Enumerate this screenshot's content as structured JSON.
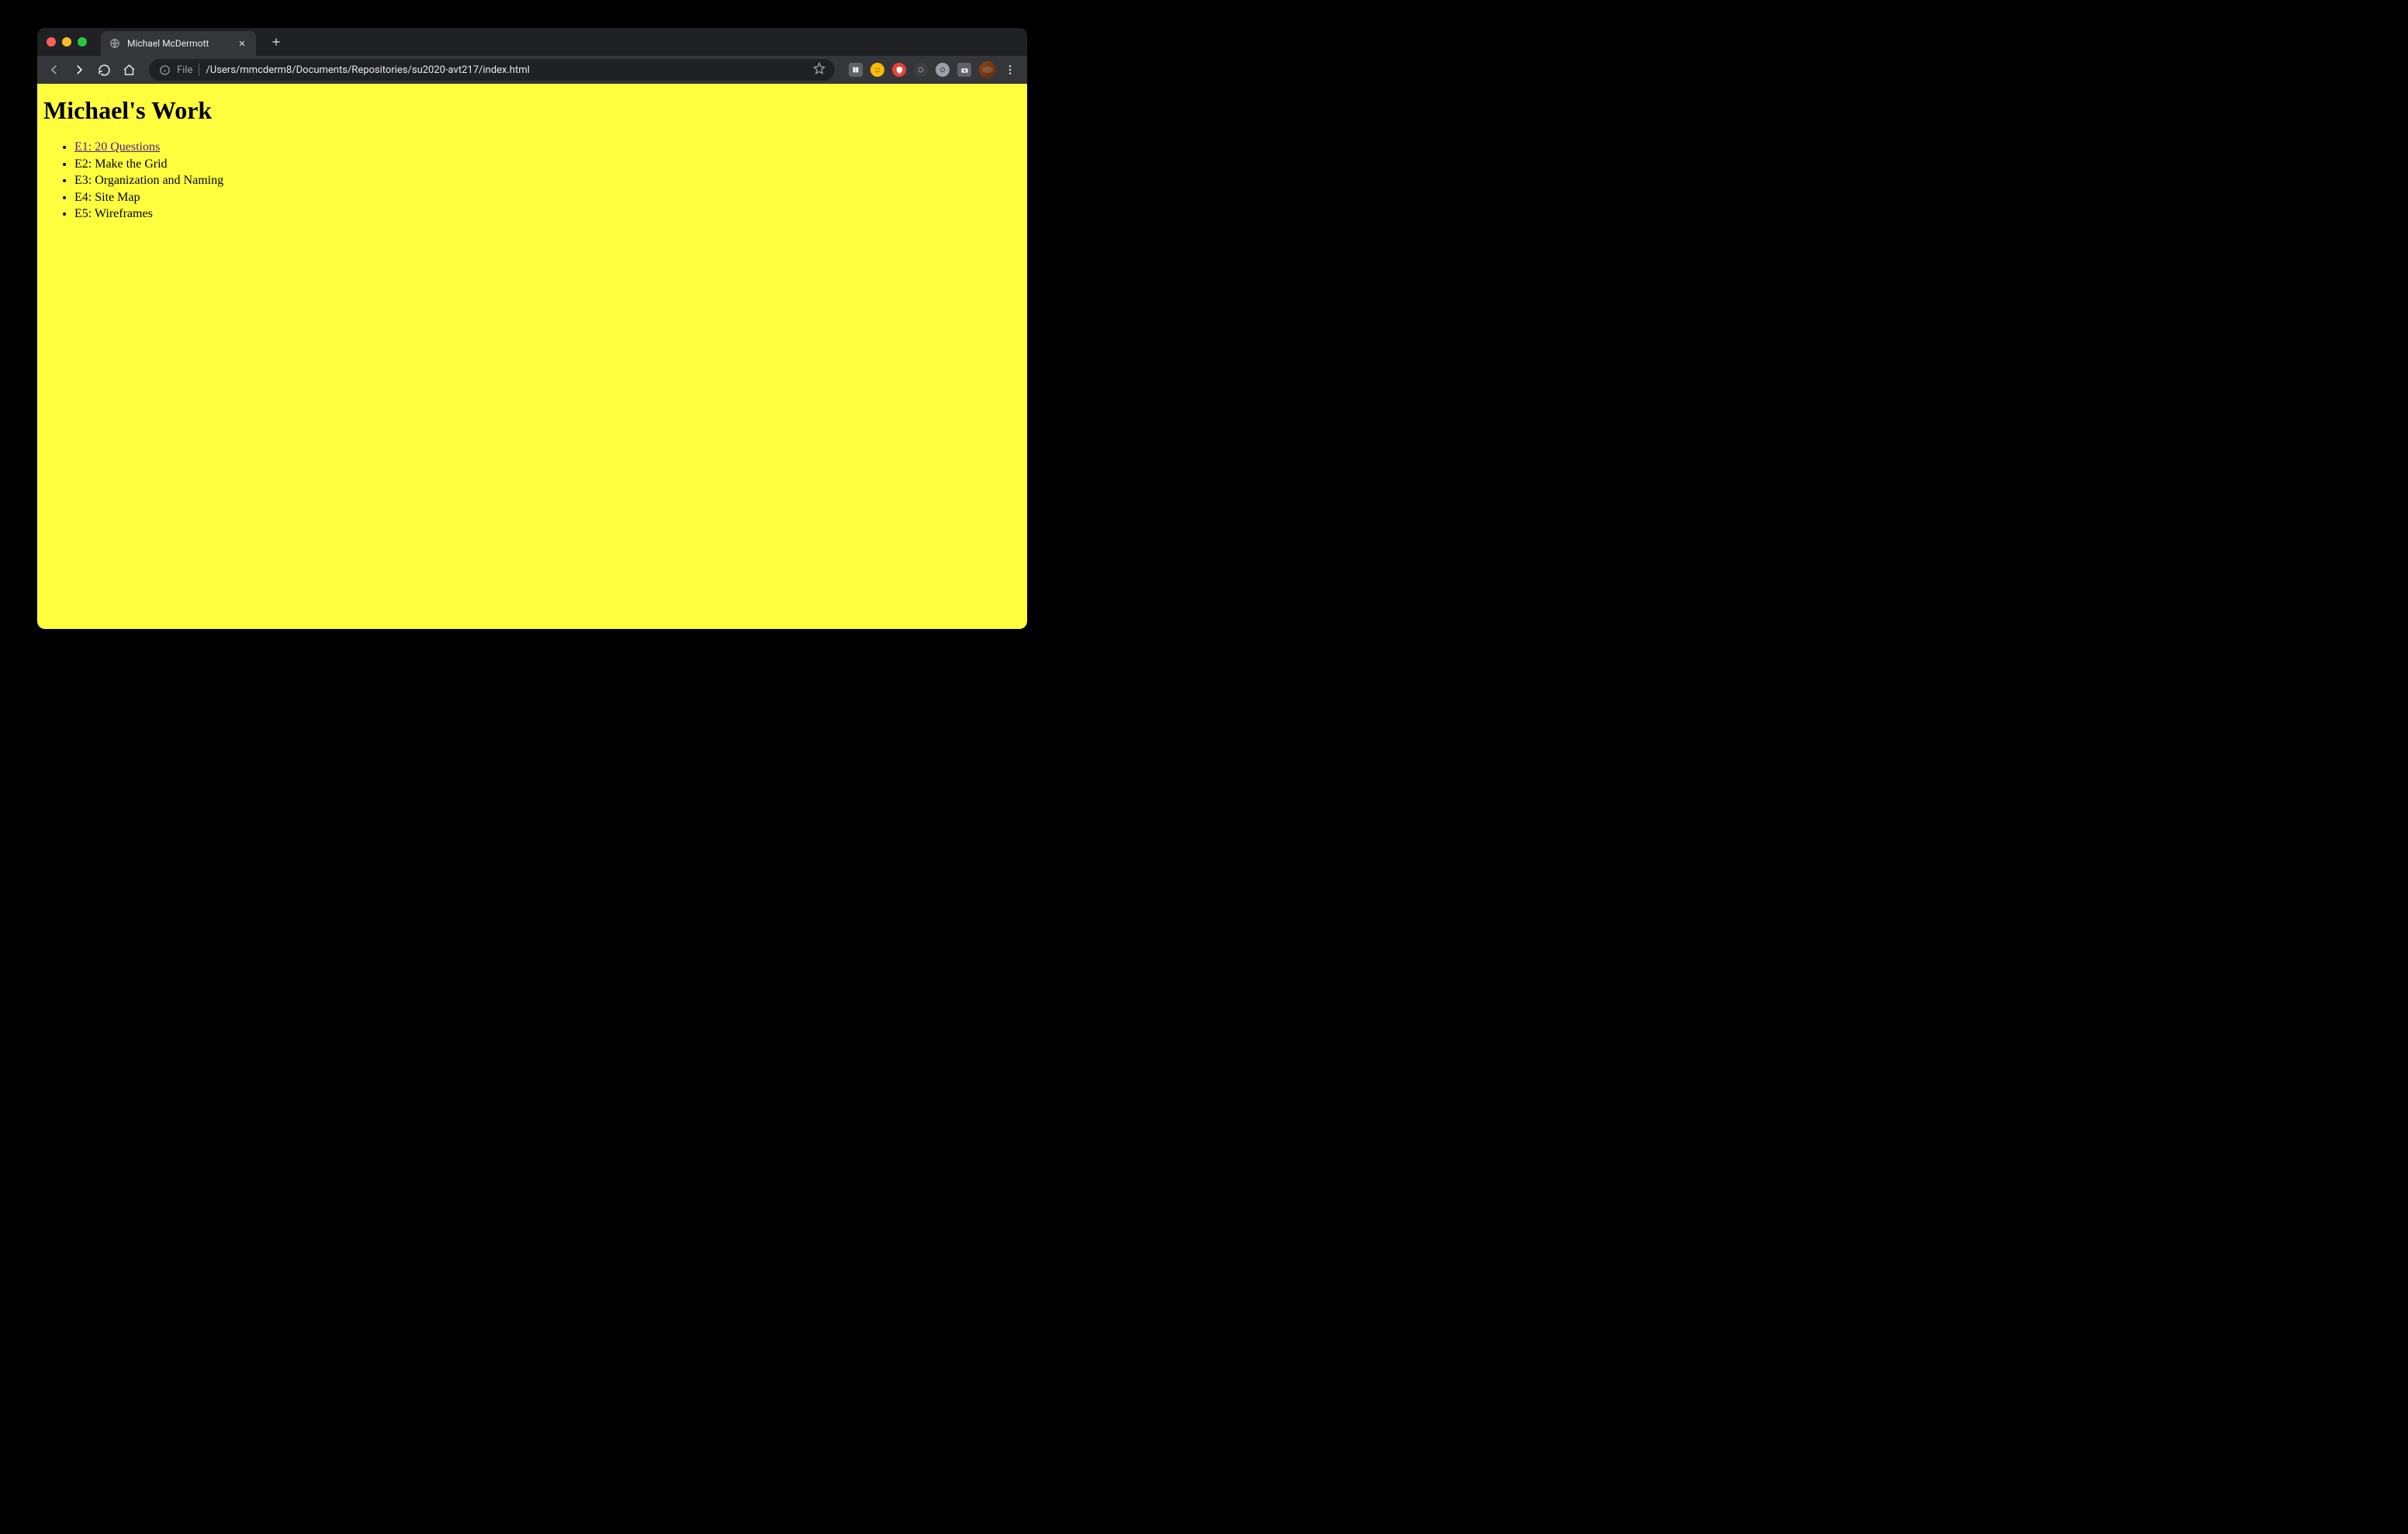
{
  "browser": {
    "tab": {
      "title": "Michael McDermott"
    },
    "address": {
      "protocol": "File",
      "path": "/Users/mmcderm8/Documents/Repositories/su2020-avt217/index.html"
    }
  },
  "page": {
    "heading": "Michael's Work",
    "items": [
      {
        "label": "E1: 20 Questions",
        "link": true
      },
      {
        "label": "E2: Make the Grid",
        "link": false
      },
      {
        "label": "E3: Organization and Naming",
        "link": false
      },
      {
        "label": "E4: Site Map",
        "link": false
      },
      {
        "label": "E5: Wireframes",
        "link": false
      }
    ]
  }
}
